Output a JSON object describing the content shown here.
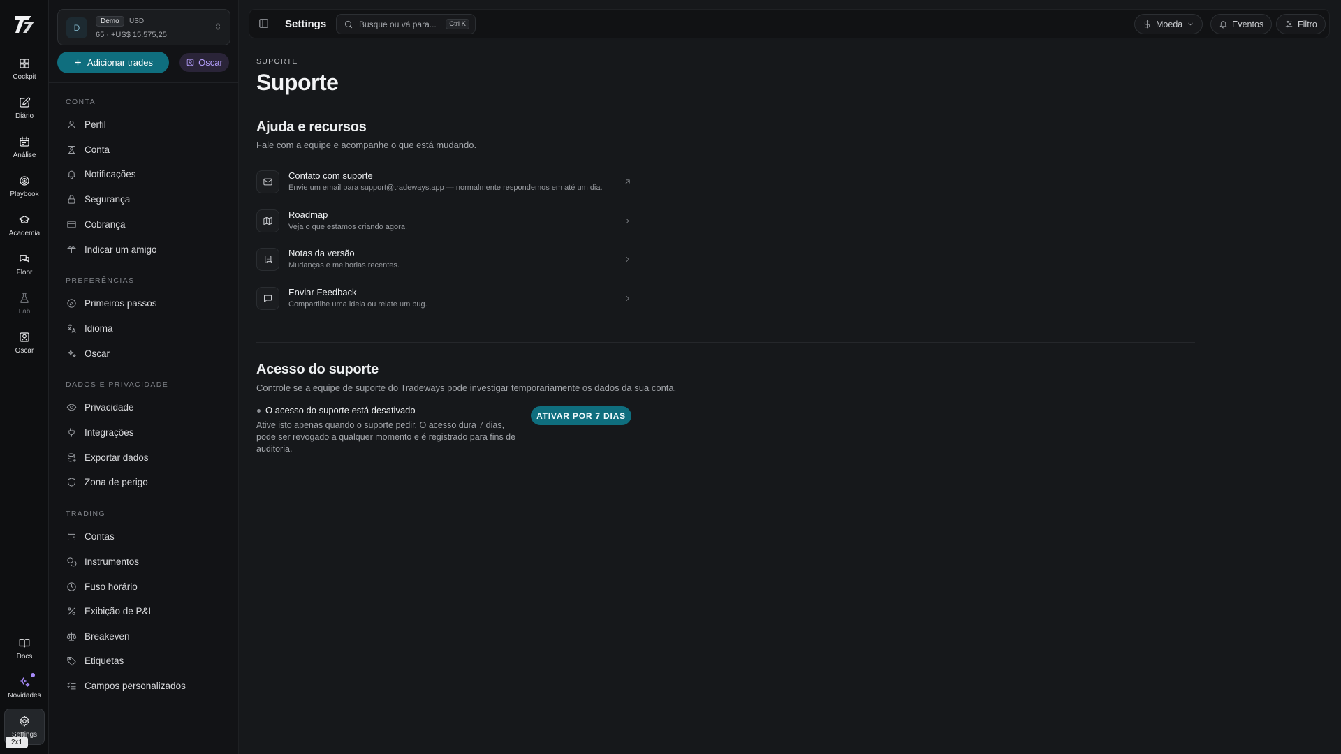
{
  "rail": {
    "items": [
      {
        "label": "Cockpit",
        "icon": "dashboard-icon"
      },
      {
        "label": "Diário",
        "icon": "journal-icon"
      },
      {
        "label": "Análise",
        "icon": "calendar-icon"
      },
      {
        "label": "Playbook",
        "icon": "target-icon"
      },
      {
        "label": "Academia",
        "icon": "graduation-cap-icon"
      },
      {
        "label": "Floor",
        "icon": "chat-icon"
      },
      {
        "label": "Lab",
        "icon": "flask-icon"
      },
      {
        "label": "Oscar",
        "icon": "user-square-icon"
      }
    ],
    "bottom": [
      {
        "label": "Docs",
        "icon": "book-icon"
      },
      {
        "label": "Novidades",
        "icon": "sparkles-icon"
      },
      {
        "label": "Settings",
        "icon": "gear-icon"
      }
    ],
    "version_chip": "2x1"
  },
  "account": {
    "avatar": "D",
    "mode": "Demo",
    "currency": "USD",
    "summary": "65 · +US$ 15.575,25"
  },
  "actions": {
    "add_trades": "Adicionar trades",
    "oscar": "Oscar"
  },
  "sidebar": {
    "sections": [
      {
        "title": "CONTA",
        "items": [
          "Perfil",
          "Conta",
          "Notificações",
          "Segurança",
          "Cobrança",
          "Indicar um amigo"
        ]
      },
      {
        "title": "PREFERÊNCIAS",
        "items": [
          "Primeiros passos",
          "Idioma",
          "Oscar"
        ]
      },
      {
        "title": "DADOS E PRIVACIDADE",
        "items": [
          "Privacidade",
          "Integrações",
          "Exportar dados",
          "Zona de perigo"
        ]
      },
      {
        "title": "TRADING",
        "items": [
          "Contas",
          "Instrumentos",
          "Fuso horário",
          "Exibição de P&L",
          "Breakeven",
          "Etiquetas",
          "Campos personalizados"
        ]
      }
    ]
  },
  "topbar": {
    "title": "Settings",
    "search_placeholder": "Busque ou vá para...",
    "search_shortcut": "Ctrl K",
    "currency": "Moeda",
    "events": "Eventos",
    "filter": "Filtro"
  },
  "main": {
    "eyebrow": "SUPORTE",
    "title": "Suporte",
    "help": {
      "heading": "Ajuda e recursos",
      "description": "Fale com a equipe e acompanhe o que está mudando.",
      "items": [
        {
          "title": "Contato com suporte",
          "subtitle": "Envie um email para support@tradeways.app — normalmente respondemos em até um dia.",
          "icon": "mail-icon",
          "arrow": "external-link-icon"
        },
        {
          "title": "Roadmap",
          "subtitle": "Veja o que estamos criando agora.",
          "icon": "map-icon",
          "arrow": "chevron-right-icon"
        },
        {
          "title": "Notas da versão",
          "subtitle": "Mudanças e melhorias recentes.",
          "icon": "scroll-icon",
          "arrow": "chevron-right-icon"
        },
        {
          "title": "Enviar Feedback",
          "subtitle": "Compartilhe uma ideia ou relate um bug.",
          "icon": "message-square-icon",
          "arrow": "chevron-right-icon"
        }
      ]
    },
    "access": {
      "heading": "Acesso do suporte",
      "description": "Controle se a equipe de suporte do Tradeways pode investigar temporariamente os dados da sua conta.",
      "status": "O acesso do suporte está desativado",
      "status_description": "Ative isto apenas quando o suporte pedir. O acesso dura 7 dias, pode ser revogado a qualquer momento e é registrado para fins de auditoria.",
      "button": "ATIVAR POR 7 DIAS"
    }
  },
  "colors": {
    "accent": "#0f6e7e",
    "oscar_accent": "#b39dfa",
    "background": "#16181b"
  }
}
